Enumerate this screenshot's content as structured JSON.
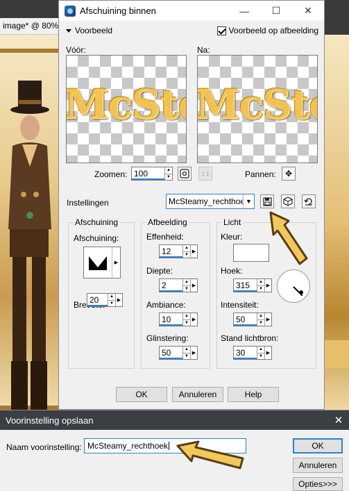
{
  "background_app": {
    "tab_title": "image* @  80%"
  },
  "dialog": {
    "title": "Afschuining binnen",
    "window_controls": {
      "minimize": "—",
      "maximize": "☐",
      "close": "✕"
    },
    "preview": {
      "label": "Voorbeeld",
      "on_image_label": "Voorbeeld op afbeelding",
      "on_image_checked": true,
      "before_label": "Vóór:",
      "after_label": "Na:",
      "preview_text": "McSteamy"
    },
    "zoom": {
      "label": "Zoomen:",
      "value": "100",
      "fit_icon": "fit-icon",
      "one_to_one_icon": "actual-size-icon"
    },
    "pan": {
      "label": "Pannen:",
      "icon": "move-icon"
    },
    "settings": {
      "label": "Instellingen",
      "preset_value": "McSteamy_rechthoek",
      "save_icon": "save-icon",
      "random_icon": "dice-icon",
      "reset_icon": "reset-icon"
    },
    "bevel_group": {
      "legend": "Afschuining",
      "bevel_label": "Afschuining:",
      "width_label": "Breedte:",
      "width_value": "20"
    },
    "image_group": {
      "legend": "Afbeelding",
      "smoothness_label": "Effenheid:",
      "smoothness_value": "12",
      "depth_label": "Diepte:",
      "depth_value": "2",
      "ambience_label": "Ambiance:",
      "ambience_value": "10",
      "shininess_label": "Glinstering:",
      "shininess_value": "50"
    },
    "light_group": {
      "legend": "Licht",
      "color_label": "Kleur:",
      "color_value": "#ffffff",
      "angle_label": "Hoek:",
      "angle_value": "315",
      "intensity_label": "Intensiteit:",
      "intensity_value": "50",
      "elevation_label": "Stand lichtbron:",
      "elevation_value": "30"
    },
    "buttons": {
      "ok": "OK",
      "cancel": "Annuleren",
      "help": "Help"
    }
  },
  "save_dialog": {
    "title": "Voorinstelling opslaan",
    "close": "✕",
    "name_label": "Naam voorinstelling:",
    "name_value": "McSteamy_rechthoek",
    "buttons": {
      "ok": "OK",
      "cancel": "Annuleren",
      "options": "Opties>>>"
    }
  },
  "colors": {
    "accent": "#2f7fd3",
    "arrow_fill": "#f2c85a",
    "arrow_outline": "#5a3d12"
  }
}
